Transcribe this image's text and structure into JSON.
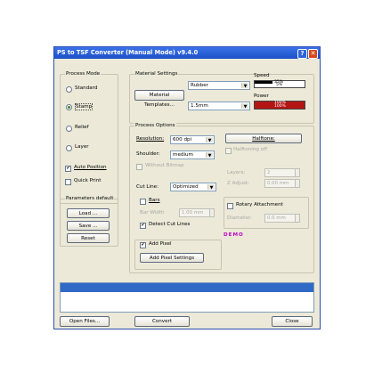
{
  "window": {
    "title": "PS to TSF Converter (Manual Mode) v9.4.0",
    "help_label": "?",
    "close_label": "✕"
  },
  "process_mode": {
    "title": "Process Mode",
    "options": [
      "Standard",
      "Stamp",
      "Relief",
      "Layer"
    ],
    "selected": "Stamp",
    "auto_position": "Auto Position",
    "quick_print": "Quick Print"
  },
  "parameters": {
    "title": "Parameters default",
    "load": "Load ...",
    "save": "Save ...",
    "reset": "Reset"
  },
  "material": {
    "title": "Material Settings",
    "material_value": "Rubber",
    "templates_button": "Material Templates...",
    "thickness_value": "1.5mm",
    "speed_label": "Speed",
    "speed_value": "35%",
    "speed_value2": "5%",
    "speed_level": 0.35,
    "power_label": "Power",
    "power_value": "100%",
    "power_value2": "100%",
    "power_level": 1.0
  },
  "process_options": {
    "title": "Process Options",
    "resolution_label": "Resolution:",
    "resolution_value": "600 dpi",
    "shoulder_label": "Shoulder:",
    "shoulder_value": "medium",
    "without_bitmap": "Without Bitmap",
    "halftone_button": "Halftone:",
    "halftoning_off": "Halftoning off",
    "layers_label": "Layers:",
    "layers_value": "2",
    "zadjust_label": "Z Adjust:",
    "zadjust_value": "0.00 mm",
    "cutline_label": "Cut Line:",
    "cutline_value": "Optimized",
    "bars": "Bars",
    "bar_width_label": "Bar Width",
    "bar_width_value": "1.00 mm",
    "detect_cut_lines": "Detect Cut Lines",
    "rotary": "Rotary Attachment",
    "diameter_label": "Diameter:",
    "diameter_value": "0.0 mm",
    "demo": "DEMO",
    "add_pixel": "Add Pixel",
    "add_pixel_settings": "Add Pixel Settings"
  },
  "footer": {
    "open_files": "Open Files...",
    "convert": "Convert",
    "close": "Close"
  }
}
